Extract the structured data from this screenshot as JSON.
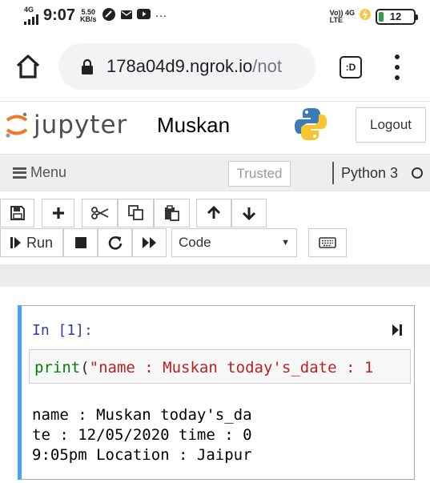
{
  "status_bar": {
    "network": "4G",
    "time": "9:07",
    "speed_value": "5.50",
    "speed_unit": "KB/s",
    "dots": "···",
    "volte_line1": "Vo)) 4G",
    "volte_line2": "LTE",
    "battery": "12"
  },
  "browser": {
    "url_host": "178a04d9.ngrok.io",
    "url_path": "/not",
    "tabs_label": ":D"
  },
  "header": {
    "logo_text": "jupyter",
    "notebook_name": "Muskan",
    "logout_label": "Logout"
  },
  "menubar": {
    "menu_label": "Menu",
    "trusted_label": "Trusted",
    "kernel_name": "Python 3"
  },
  "toolbar": {
    "run_label": "Run",
    "cell_type": "Code"
  },
  "cell": {
    "prompt": "In [1]:",
    "code_fn": "print",
    "code_open": "(",
    "code_str": "\"name : Muskan today's_date : 1",
    "output_lines": [
      "name : Muskan today's_da",
      "te : 12/05/2020 time : 0",
      "9:05pm Location : Jaipur"
    ]
  },
  "colors": {
    "cell_accent": "#42a5f5",
    "prompt": "#303f9f",
    "code_builtin": "#008000",
    "code_string": "#ba2121",
    "jupyter_orange": "#f37726",
    "battery_fill": "#2ea043"
  },
  "icons": [
    "signal-icon",
    "data-saver-icon",
    "mail-icon",
    "youtube-icon",
    "charging-icon",
    "home-icon",
    "lock-icon",
    "tabs-icon",
    "overflow-menu-icon",
    "python-logo",
    "save-icon",
    "plus-icon",
    "cut-icon",
    "copy-icon",
    "paste-icon",
    "arrow-up-icon",
    "arrow-down-icon",
    "run-icon",
    "stop-icon",
    "restart-icon",
    "fast-forward-icon",
    "keyboard-icon",
    "run-cell-icon"
  ]
}
